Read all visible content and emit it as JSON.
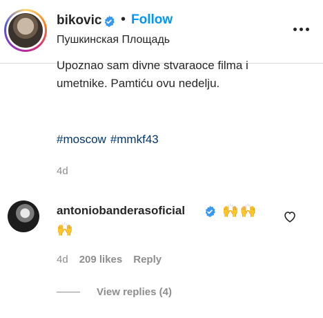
{
  "header": {
    "username": "bikovic",
    "separator": "•",
    "follow_label": "Follow",
    "location": "Пушкинская Площадь"
  },
  "post": {
    "caption_line1": "Upoznao sam divne stvaraoce filma i",
    "caption_line2": "umetnike. Pamtiću ovu nedelju.",
    "hashtags": [
      "#moscow",
      "#mmkf43"
    ],
    "time": "4d"
  },
  "comment": {
    "username": "antoniobanderasoficial",
    "emoji_inline": "🙌🙌",
    "emoji_second_line": "🙌",
    "time": "4d",
    "likes": "209 likes",
    "reply_label": "Reply",
    "view_replies": "View replies (4)"
  },
  "colors": {
    "accent": "#0095f6",
    "hashtag": "#00376b",
    "muted": "#8e8e8e",
    "verified": "#3897f0"
  }
}
